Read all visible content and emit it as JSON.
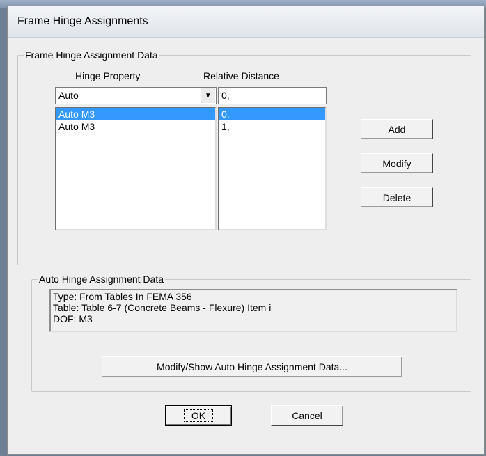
{
  "window": {
    "title": "Frame Hinge Assignments"
  },
  "hinge_group": {
    "legend": "Frame Hinge Assignment Data",
    "hinge_property_header": "Hinge Property",
    "relative_distance_header": "Relative Distance",
    "hinge_property_value": "Auto",
    "relative_distance_value": "0,",
    "hinge_list": [
      "Auto  M3",
      "Auto  M3"
    ],
    "distance_list": [
      "0,",
      "1,"
    ],
    "selected_index": 0,
    "add_label": "Add",
    "modify_label": "Modify",
    "delete_label": "Delete"
  },
  "auto_group": {
    "legend": "Auto Hinge Assignment Data",
    "lines": [
      "Type:  From Tables In FEMA 356",
      "Table:  Table 6-7 (Concrete Beams - Flexure) Item i",
      "DOF:  M3"
    ],
    "modify_show_label": "Modify/Show Auto Hinge Assignment Data..."
  },
  "footer": {
    "ok_label": "OK",
    "cancel_label": "Cancel"
  },
  "icons": {
    "dropdown": "chevron-down-icon"
  },
  "colors": {
    "selection": "#3399ff",
    "dialog_bg": "#eeeeee"
  }
}
